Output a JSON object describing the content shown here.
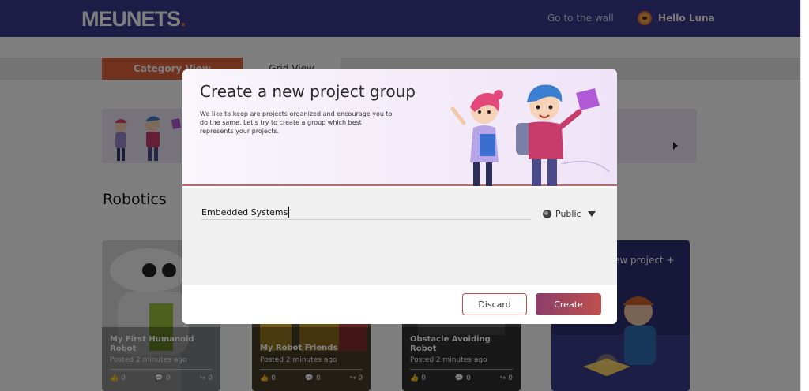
{
  "header": {
    "logo_text": "MEUNETS",
    "logo_dot": ".",
    "nav_wall": "Go to the wall",
    "greeting": "Hello Luna",
    "avatar_icon": "user-avatar-icon",
    "brand_color": "#3b3a8f",
    "accent_color": "#e06a4a"
  },
  "view_tabs": {
    "category": "Category View",
    "grid": "Grid View"
  },
  "section": {
    "title": "Robotics"
  },
  "cards": [
    {
      "title": "My First Humanoid Robot",
      "posted": "Posted 2 minutes ago",
      "likes": "0",
      "comments": "0",
      "shares": "0"
    },
    {
      "title": "My Robot Friends",
      "posted": "Posted 2 minutes ago",
      "likes": "0",
      "comments": "0",
      "shares": "0"
    },
    {
      "title": "Obstacle Avoiding Robot",
      "posted": "Posted 2 minutes ago",
      "likes": "0",
      "comments": "0",
      "shares": "0"
    }
  ],
  "new_project": {
    "label": "New project +"
  },
  "modal": {
    "title": "Create a new project group",
    "description": "We like to keep are projects organized and encourage you to do the same. Let's try to create a group which best represents your projects.",
    "group_name_value": "Embedded Systems",
    "visibility": "Public",
    "discard_label": "Discard",
    "create_label": "Create",
    "create_gradient": [
      "#8b3e6a",
      "#c0504d"
    ]
  }
}
